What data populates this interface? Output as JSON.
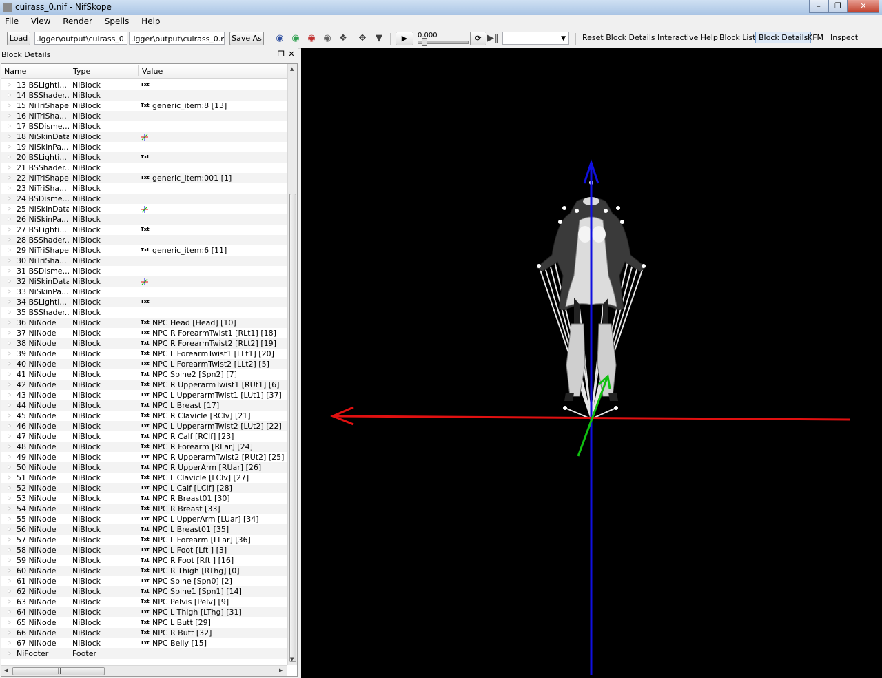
{
  "window": {
    "title": "cuirass_0.nif - NifSkope"
  },
  "menu": [
    "File",
    "View",
    "Render",
    "Spells",
    "Help"
  ],
  "toolbar": {
    "load_label": "Load",
    "load_path": ".igger\\output\\cuirass_0.nif",
    "save_path": ".igger\\output\\cuirass_0.nif",
    "save_as_label": "Save As",
    "time_value": "0.000",
    "reset_block_details": "Reset Block Details",
    "interactive_help": "Interactive Help",
    "block_list": "Block List",
    "block_details": "Block Details",
    "kfm": "KFM",
    "inspect": "Inspect"
  },
  "panel": {
    "title": "Block Details",
    "columns": [
      "Name",
      "Type",
      "Value"
    ],
    "rows": [
      {
        "name": "13 BSLighti...",
        "type": "NiBlock",
        "icon": "txt",
        "value": ""
      },
      {
        "name": "14 BSShader...",
        "type": "NiBlock",
        "icon": "",
        "value": ""
      },
      {
        "name": "15 NiTriShape",
        "type": "NiBlock",
        "icon": "txt",
        "value": "generic_item:8 [13]"
      },
      {
        "name": "16 NiTriSha...",
        "type": "NiBlock",
        "icon": "",
        "value": ""
      },
      {
        "name": "17 BSDisme...",
        "type": "NiBlock",
        "icon": "",
        "value": ""
      },
      {
        "name": "18 NiSkinData",
        "type": "NiBlock",
        "icon": "axes",
        "value": ""
      },
      {
        "name": "19 NiSkinPa...",
        "type": "NiBlock",
        "icon": "",
        "value": ""
      },
      {
        "name": "20 BSLighti...",
        "type": "NiBlock",
        "icon": "txt",
        "value": ""
      },
      {
        "name": "21 BSShader...",
        "type": "NiBlock",
        "icon": "",
        "value": ""
      },
      {
        "name": "22 NiTriShape",
        "type": "NiBlock",
        "icon": "txt",
        "value": "generic_item:001 [1]"
      },
      {
        "name": "23 NiTriSha...",
        "type": "NiBlock",
        "icon": "",
        "value": ""
      },
      {
        "name": "24 BSDisme...",
        "type": "NiBlock",
        "icon": "",
        "value": ""
      },
      {
        "name": "25 NiSkinData",
        "type": "NiBlock",
        "icon": "axes",
        "value": ""
      },
      {
        "name": "26 NiSkinPa...",
        "type": "NiBlock",
        "icon": "",
        "value": ""
      },
      {
        "name": "27 BSLighti...",
        "type": "NiBlock",
        "icon": "txt",
        "value": ""
      },
      {
        "name": "28 BSShader...",
        "type": "NiBlock",
        "icon": "",
        "value": ""
      },
      {
        "name": "29 NiTriShape",
        "type": "NiBlock",
        "icon": "txt",
        "value": "generic_item:6 [11]"
      },
      {
        "name": "30 NiTriSha...",
        "type": "NiBlock",
        "icon": "",
        "value": ""
      },
      {
        "name": "31 BSDisme...",
        "type": "NiBlock",
        "icon": "",
        "value": ""
      },
      {
        "name": "32 NiSkinData",
        "type": "NiBlock",
        "icon": "axes",
        "value": ""
      },
      {
        "name": "33 NiSkinPa...",
        "type": "NiBlock",
        "icon": "",
        "value": ""
      },
      {
        "name": "34 BSLighti...",
        "type": "NiBlock",
        "icon": "txt",
        "value": ""
      },
      {
        "name": "35 BSShader...",
        "type": "NiBlock",
        "icon": "",
        "value": ""
      },
      {
        "name": "36 NiNode",
        "type": "NiBlock",
        "icon": "txt",
        "value": "NPC Head [Head] [10]"
      },
      {
        "name": "37 NiNode",
        "type": "NiBlock",
        "icon": "txt",
        "value": "NPC R ForearmTwist1 [RLt1] [18]"
      },
      {
        "name": "38 NiNode",
        "type": "NiBlock",
        "icon": "txt",
        "value": "NPC R ForearmTwist2 [RLt2] [19]"
      },
      {
        "name": "39 NiNode",
        "type": "NiBlock",
        "icon": "txt",
        "value": "NPC L ForearmTwist1 [LLt1] [20]"
      },
      {
        "name": "40 NiNode",
        "type": "NiBlock",
        "icon": "txt",
        "value": "NPC L ForearmTwist2 [LLt2] [5]"
      },
      {
        "name": "41 NiNode",
        "type": "NiBlock",
        "icon": "txt",
        "value": "NPC Spine2 [Spn2] [7]"
      },
      {
        "name": "42 NiNode",
        "type": "NiBlock",
        "icon": "txt",
        "value": "NPC R UpperarmTwist1 [RUt1] [6]"
      },
      {
        "name": "43 NiNode",
        "type": "NiBlock",
        "icon": "txt",
        "value": "NPC L UpperarmTwist1 [LUt1] [37]"
      },
      {
        "name": "44 NiNode",
        "type": "NiBlock",
        "icon": "txt",
        "value": "NPC L Breast [17]"
      },
      {
        "name": "45 NiNode",
        "type": "NiBlock",
        "icon": "txt",
        "value": "NPC R Clavicle [RClv] [21]"
      },
      {
        "name": "46 NiNode",
        "type": "NiBlock",
        "icon": "txt",
        "value": "NPC L UpperarmTwist2 [LUt2] [22]"
      },
      {
        "name": "47 NiNode",
        "type": "NiBlock",
        "icon": "txt",
        "value": "NPC R Calf [RClf] [23]"
      },
      {
        "name": "48 NiNode",
        "type": "NiBlock",
        "icon": "txt",
        "value": "NPC R Forearm [RLar] [24]"
      },
      {
        "name": "49 NiNode",
        "type": "NiBlock",
        "icon": "txt",
        "value": "NPC R UpperarmTwist2 [RUt2] [25]"
      },
      {
        "name": "50 NiNode",
        "type": "NiBlock",
        "icon": "txt",
        "value": "NPC R UpperArm [RUar] [26]"
      },
      {
        "name": "51 NiNode",
        "type": "NiBlock",
        "icon": "txt",
        "value": "NPC L Clavicle [LClv] [27]"
      },
      {
        "name": "52 NiNode",
        "type": "NiBlock",
        "icon": "txt",
        "value": "NPC L Calf [LClf] [28]"
      },
      {
        "name": "53 NiNode",
        "type": "NiBlock",
        "icon": "txt",
        "value": "NPC R Breast01 [30]"
      },
      {
        "name": "54 NiNode",
        "type": "NiBlock",
        "icon": "txt",
        "value": "NPC R Breast [33]"
      },
      {
        "name": "55 NiNode",
        "type": "NiBlock",
        "icon": "txt",
        "value": "NPC L UpperArm [LUar] [34]"
      },
      {
        "name": "56 NiNode",
        "type": "NiBlock",
        "icon": "txt",
        "value": "NPC L Breast01 [35]"
      },
      {
        "name": "57 NiNode",
        "type": "NiBlock",
        "icon": "txt",
        "value": "NPC L Forearm [LLar] [36]"
      },
      {
        "name": "58 NiNode",
        "type": "NiBlock",
        "icon": "txt",
        "value": "NPC L Foot [Lft ] [3]"
      },
      {
        "name": "59 NiNode",
        "type": "NiBlock",
        "icon": "txt",
        "value": "NPC R Foot [Rft ] [16]"
      },
      {
        "name": "60 NiNode",
        "type": "NiBlock",
        "icon": "txt",
        "value": "NPC R Thigh [RThg] [0]"
      },
      {
        "name": "61 NiNode",
        "type": "NiBlock",
        "icon": "txt",
        "value": "NPC Spine [Spn0] [2]"
      },
      {
        "name": "62 NiNode",
        "type": "NiBlock",
        "icon": "txt",
        "value": "NPC Spine1 [Spn1] [14]"
      },
      {
        "name": "63 NiNode",
        "type": "NiBlock",
        "icon": "txt",
        "value": "NPC Pelvis [Pelv] [9]"
      },
      {
        "name": "64 NiNode",
        "type": "NiBlock",
        "icon": "txt",
        "value": "NPC L Thigh [LThg] [31]"
      },
      {
        "name": "65 NiNode",
        "type": "NiBlock",
        "icon": "txt",
        "value": "NPC L Butt [29]"
      },
      {
        "name": "66 NiNode",
        "type": "NiBlock",
        "icon": "txt",
        "value": "NPC R Butt [32]"
      },
      {
        "name": "67 NiNode",
        "type": "NiBlock",
        "icon": "txt",
        "value": "NPC Belly [15]"
      },
      {
        "name": "NiFooter",
        "type": "Footer",
        "icon": "",
        "value": ""
      }
    ]
  },
  "txt_icon_label": "Txt",
  "colors": {
    "x_axis": "#e01010",
    "y_axis": "#10c010",
    "z_axis": "#1010e0",
    "viewport_bg": "#000000"
  }
}
